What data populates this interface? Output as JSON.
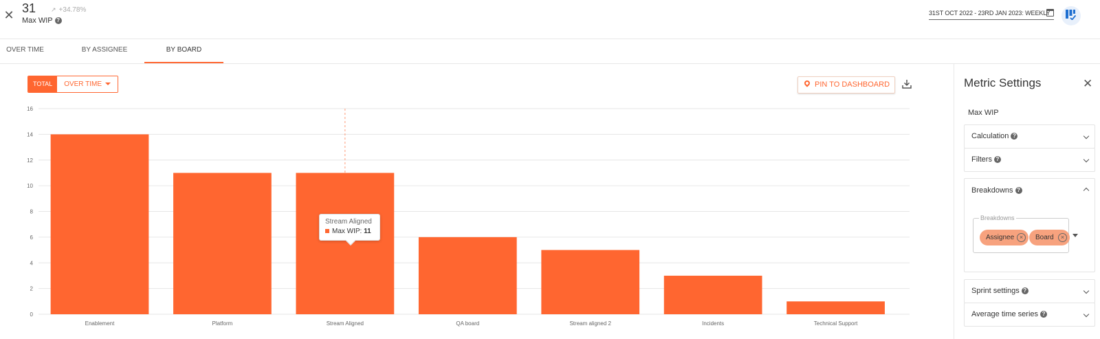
{
  "header": {
    "value": "31",
    "trend": "+34.78%",
    "name": "Max WIP",
    "date_range": "31ST OCT 2022 - 23RD JAN 2023: WEEKLY"
  },
  "tabs": [
    {
      "label": "OVER TIME"
    },
    {
      "label": "BY ASSIGNEE"
    },
    {
      "label": "BY BOARD",
      "active": true
    }
  ],
  "toolbar": {
    "total_label": "TOTAL",
    "over_time_label": "OVER TIME",
    "pin_label": "PIN TO DASHBOARD"
  },
  "tooltip": {
    "title": "Stream Aligned",
    "series": "Max WIP: ",
    "value": "11"
  },
  "settings": {
    "title": "Metric Settings",
    "metric": "Max WIP",
    "calculation": "Calculation",
    "filters": "Filters",
    "breakdowns": "Breakdowns",
    "breakdowns_field_label": "Breakdowns",
    "chips": [
      "Assignee",
      "Board"
    ],
    "sprint_settings": "Sprint settings",
    "average_time_series": "Average time series"
  },
  "colors": {
    "accent": "#ff6630",
    "chip": "#f7a27e"
  },
  "chart_data": {
    "type": "bar",
    "categories": [
      "Enablement",
      "Platform",
      "Stream Aligned",
      "QA board",
      "Stream aligned 2",
      "Incidents",
      "Technical Support"
    ],
    "series": [
      {
        "name": "Max WIP",
        "values": [
          14,
          11,
          11,
          6,
          5,
          3,
          1
        ]
      }
    ],
    "ylim": [
      0,
      16
    ],
    "yticks": [
      "0",
      "2",
      "4",
      "6",
      "8",
      "10",
      "12",
      "14",
      "16"
    ],
    "grid": true,
    "highlighted_category": "Stream Aligned"
  }
}
